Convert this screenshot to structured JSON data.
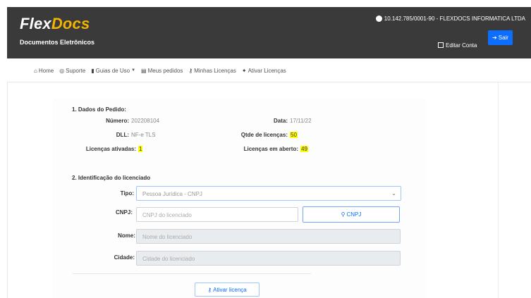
{
  "header": {
    "logo_flex": "Flex",
    "logo_docs": "Docs",
    "tagline": "Documentos Eletrônicos",
    "company": "10.142.785/0001-90 - FLEXDOCS INFORMATICA LTDA",
    "edit_label": "Editar Conta",
    "exit_label": "Sair"
  },
  "nav": {
    "items": [
      {
        "icon": "home-icon",
        "label": "Home"
      },
      {
        "icon": "support-icon",
        "label": "Suporte"
      },
      {
        "icon": "book-icon",
        "label": "Guias de Uso"
      },
      {
        "icon": "orders-icon",
        "label": "Meus pedidos"
      },
      {
        "icon": "key-icon",
        "label": "Minhas Licenças"
      },
      {
        "icon": "bolt-icon",
        "label": "Ativar Licenças"
      }
    ]
  },
  "pedido": {
    "title": "1. Dados do Pedido:",
    "numero_label": "Número:",
    "numero_value": "202208104",
    "data_label": "Data:",
    "data_value": "17/11/22",
    "dll_label": "DLL:",
    "dll_value": "NF-e TLS",
    "qtde_label": "Qtde de licenças:",
    "qtde_value": "50",
    "ativadas_label": "Licenças ativadas:",
    "ativadas_value": "1",
    "aberto_label": "Licenças em aberto:",
    "aberto_value": "49"
  },
  "licenciado": {
    "title": "2. Identificação do licenciado",
    "tipo_label": "Tipo:",
    "tipo_value": "Pessoa Jurídica - CNPJ",
    "cnpj_label": "CNPJ:",
    "cnpj_placeholder": "CNPJ do licenciado",
    "cnpj_button": "CNPJ",
    "nome_label": "Nome:",
    "nome_placeholder": "Nome do licenciado",
    "cidade_label": "Cidade:",
    "cidade_placeholder": "Cidade do licenciado",
    "activate_button": "Ativar licença"
  },
  "colors": {
    "header_bg": "#3a3a3a",
    "logo_accent": "#f2b400",
    "primary": "#0d6efd",
    "highlight": "#ffff00"
  }
}
